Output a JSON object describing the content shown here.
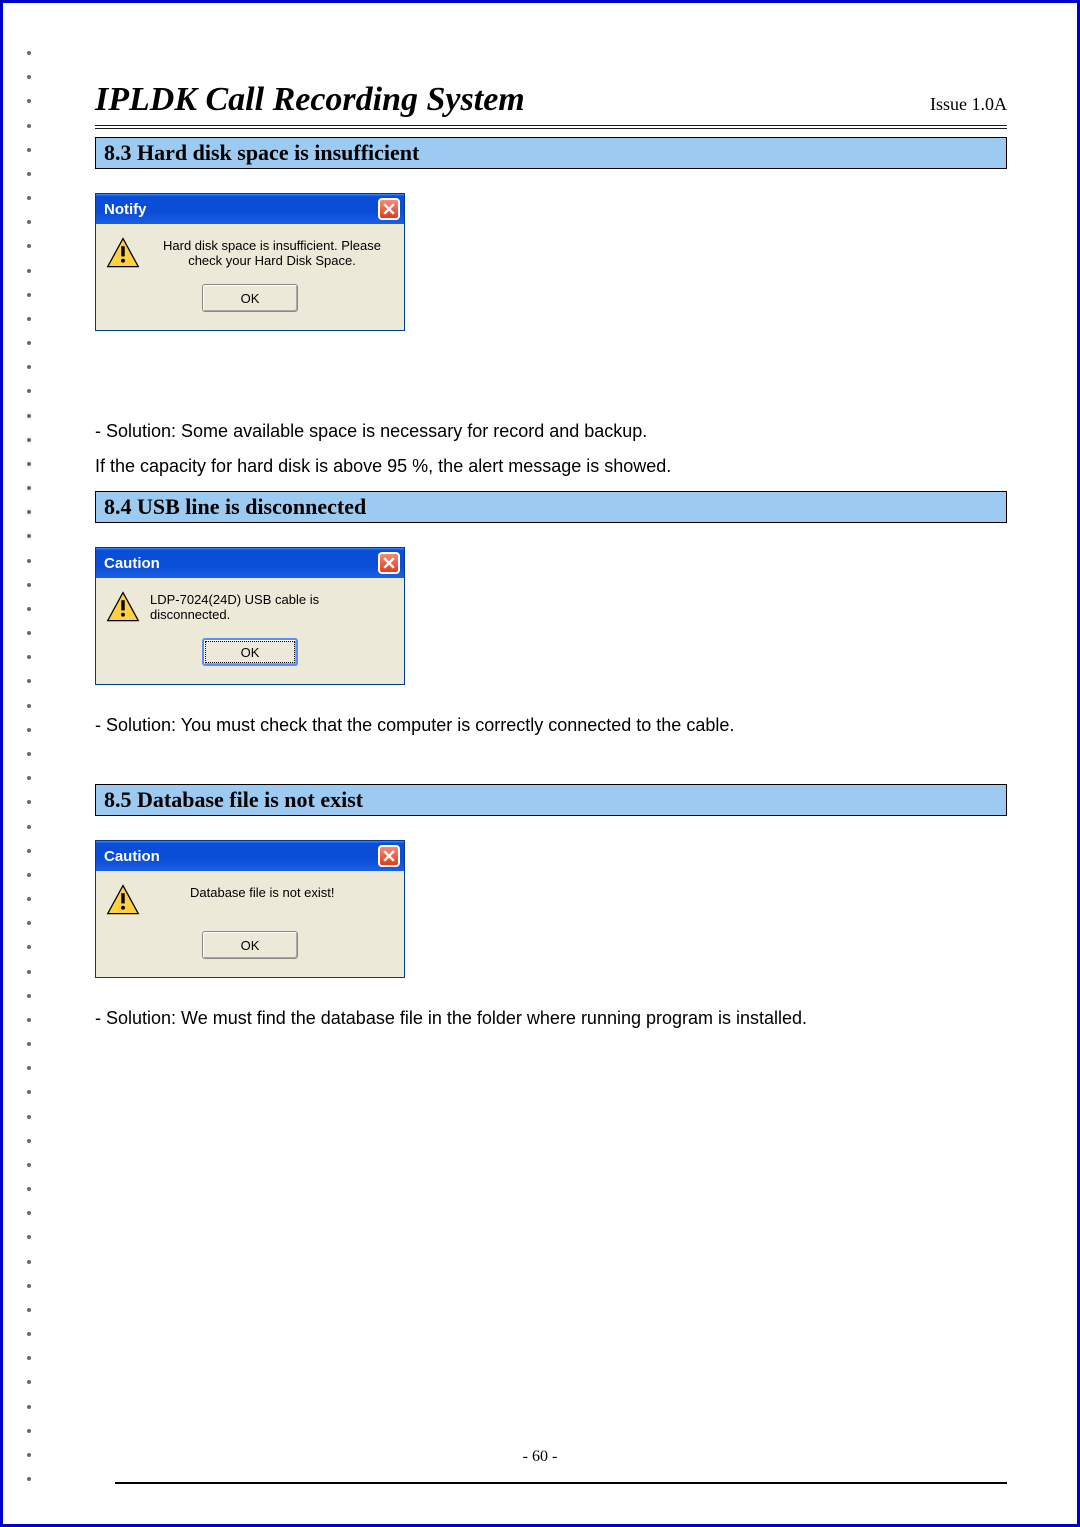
{
  "doc": {
    "title": "IPLDK Call Recording System",
    "issue": "Issue 1.0A",
    "page_label": "- 60 -"
  },
  "sections": {
    "s83": {
      "heading": "8.3 Hard disk space is insufficient"
    },
    "s84": {
      "heading": "8.4 USB line is disconnected"
    },
    "s85": {
      "heading": "8.5 Database file is not exist"
    }
  },
  "dialogs": {
    "notify": {
      "title": "Notify",
      "message": "Hard disk space is insufficient. Please check your Hard Disk Space.",
      "ok": "OK"
    },
    "caution_usb": {
      "title": "Caution",
      "message": "LDP-7024(24D) USB cable is disconnected.",
      "ok": "OK"
    },
    "caution_db": {
      "title": "Caution",
      "message": "Database file is not exist!",
      "ok": "OK"
    }
  },
  "body": {
    "s83_sol": "- Solution: Some available space is necessary for record and backup.",
    "s83_note": "If the capacity for hard disk is above 95 %, the alert message is showed.",
    "s84_sol": "- Solution: You must check that the computer is correctly connected to the cable.",
    "s85_sol": "- Solution: We must find the database file in the folder where running program is installed."
  }
}
